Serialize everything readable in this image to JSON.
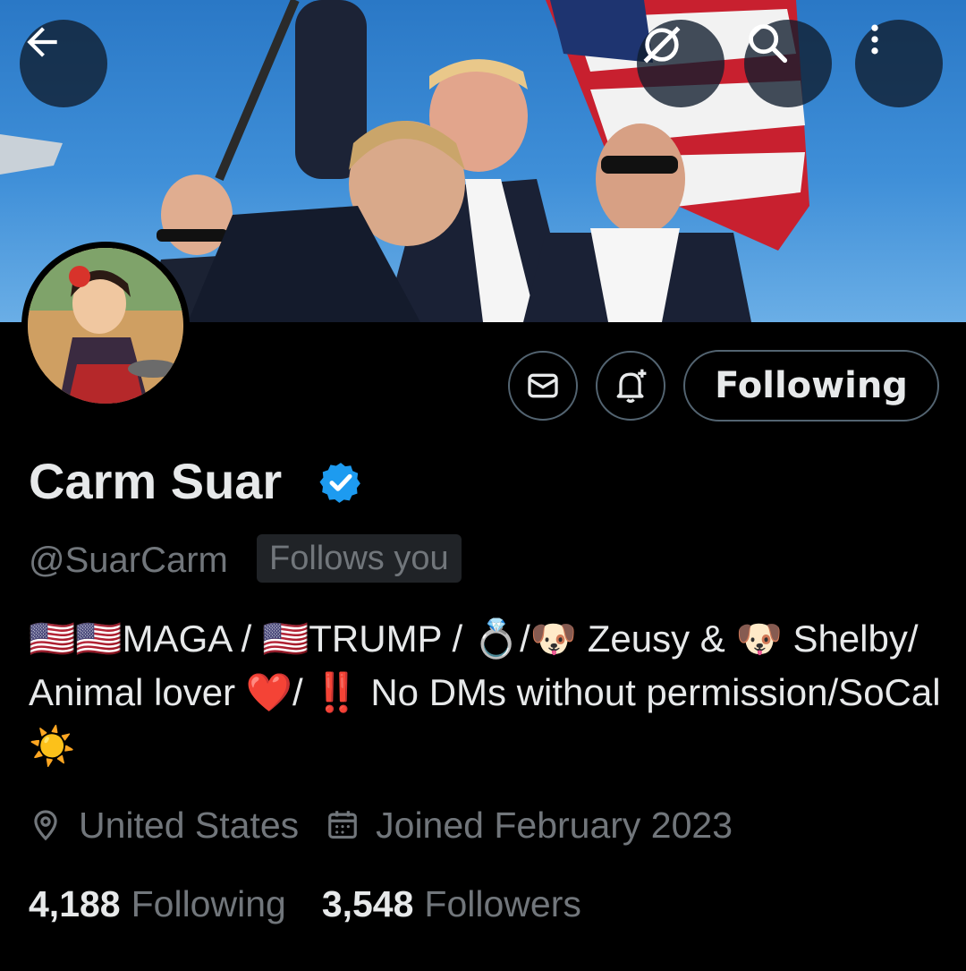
{
  "header": {
    "back_icon": "arrow-left-icon",
    "grok_icon": "grok-icon",
    "search_icon": "search-icon",
    "more_icon": "more-vertical-icon"
  },
  "profile": {
    "name": "Carm Suar",
    "verified": true,
    "handle": "@SuarCarm",
    "follows_you_label": "Follows you",
    "bio": "🇺🇸🇺🇸MAGA / 🇺🇸TRUMP / 💍/🐶 Zeusy & 🐶 Shelby/ Animal lover ❤️/ ‼️ No DMs without permission/SoCal ☀️",
    "location": "United States",
    "joined": "Joined February 2023",
    "following_count": "4,188",
    "following_label": "Following",
    "followers_count": "3,548",
    "followers_label": "Followers"
  },
  "actions": {
    "message_icon": "mail-icon",
    "notify_icon": "bell-plus-icon",
    "follow_button_label": "Following"
  },
  "colors": {
    "background": "#000000",
    "primary_text": "#e7e9ea",
    "secondary_text": "#71767b",
    "verified_blue": "#1d9bf0",
    "button_border": "#536471"
  }
}
